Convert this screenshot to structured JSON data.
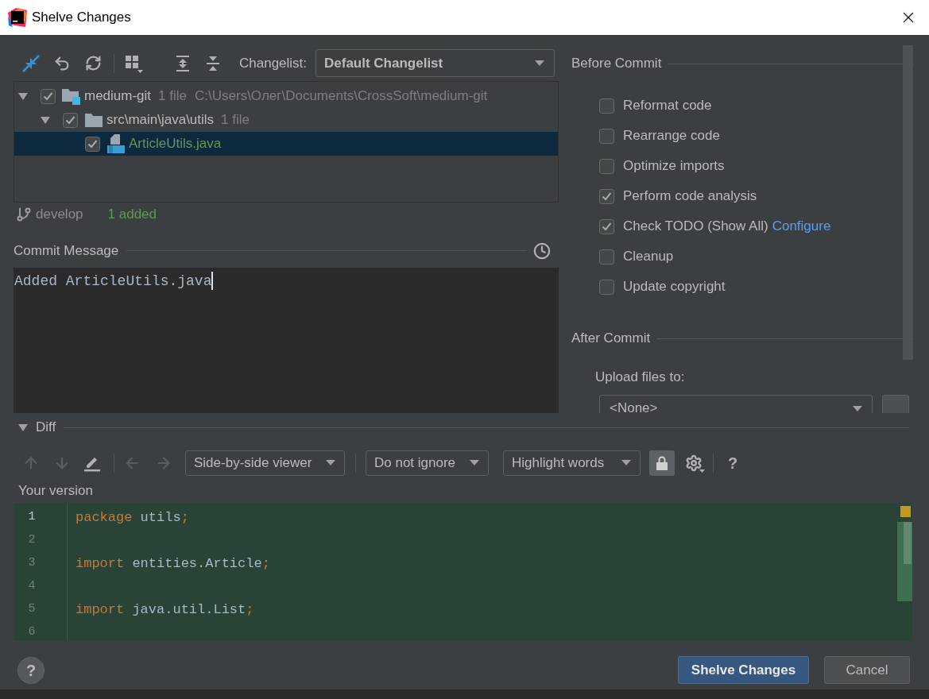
{
  "window": {
    "title": "Shelve Changes"
  },
  "toolbar": {
    "changelist_label": "Changelist:",
    "changelist": "Default Changelist"
  },
  "tree": [
    {
      "kind": "module",
      "name": "medium-git",
      "count": "1 file",
      "path": "C:\\Users\\Олег\\Documents\\CrossSoft\\medium-git",
      "added": false,
      "checked": true,
      "expanded": true,
      "selected": false,
      "children": [
        {
          "kind": "folder",
          "name": "src\\main\\java\\utils",
          "count": "1 file",
          "added": false,
          "checked": true,
          "expanded": true,
          "selected": false,
          "children": [
            {
              "kind": "file",
              "name": "ArticleUtils.java",
              "added": true,
              "checked": true,
              "selected": true
            }
          ]
        }
      ]
    }
  ],
  "branch": {
    "name": "develop",
    "summary": "1 added"
  },
  "commit_message": {
    "label": "Commit Message",
    "value": "Added ArticleUtils.java"
  },
  "before_commit": {
    "title": "Before Commit",
    "options": [
      {
        "label": "Reformat code",
        "checked": false
      },
      {
        "label": "Rearrange code",
        "checked": false
      },
      {
        "label": "Optimize imports",
        "checked": false
      },
      {
        "label": "Perform code analysis",
        "checked": true
      },
      {
        "label": "Check TODO (Show All)",
        "checked": true,
        "link": "Configure"
      },
      {
        "label": "Cleanup",
        "checked": false
      },
      {
        "label": "Update copyright",
        "checked": false
      }
    ]
  },
  "after_commit": {
    "title": "After Commit",
    "upload_label": "Upload files to:",
    "upload_target": "<None>"
  },
  "diff": {
    "title": "Diff",
    "expanded": true,
    "change_nav": {
      "disabled": true
    },
    "file_nav": {
      "disabled": true
    },
    "viewer": "Side-by-side viewer",
    "ignore": "Do not ignore",
    "highlight": "Highlight words",
    "locked": true,
    "help": "?",
    "version_label": "Your version",
    "lines": [
      {
        "number": "1",
        "current": true,
        "tokens": [
          {
            "kind": "keyword",
            "text": "package"
          },
          {
            "kind": "plain",
            "text": " utils"
          },
          {
            "kind": "punct",
            "text": ";"
          }
        ]
      },
      {
        "number": "2",
        "current": false
      },
      {
        "number": "3",
        "current": false,
        "tokens": [
          {
            "kind": "keyword",
            "text": "import"
          },
          {
            "kind": "plain",
            "text": " entities.Article"
          },
          {
            "kind": "punct",
            "text": ";"
          }
        ]
      },
      {
        "number": "4",
        "current": false
      },
      {
        "number": "5",
        "current": false,
        "tokens": [
          {
            "kind": "keyword",
            "text": "import"
          },
          {
            "kind": "plain",
            "text": " java.util.List"
          },
          {
            "kind": "punct",
            "text": ";"
          }
        ]
      },
      {
        "number": "6",
        "current": false
      }
    ]
  },
  "footer": {
    "help": "?",
    "buttons": [
      {
        "kind": "primary",
        "label": "Shelve Changes"
      },
      {
        "kind": "secondary",
        "label": "Cancel"
      }
    ]
  }
}
